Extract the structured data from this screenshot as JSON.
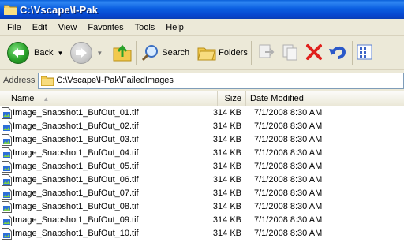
{
  "window": {
    "title": "C:\\Vscape\\I-Pak"
  },
  "menu": [
    "File",
    "Edit",
    "View",
    "Favorites",
    "Tools",
    "Help"
  ],
  "toolbar": {
    "back_label": "Back",
    "search_label": "Search",
    "folders_label": "Folders"
  },
  "address": {
    "label": "Address",
    "value": "C:\\Vscape\\I-Pak\\FailedImages"
  },
  "columns": {
    "name": "Name",
    "size": "Size",
    "date": "Date Modified"
  },
  "files": [
    {
      "name": "Image_Snapshot1_BufOut_01.tif",
      "size": "314 KB",
      "date": "7/1/2008 8:30 AM"
    },
    {
      "name": "Image_Snapshot1_BufOut_02.tif",
      "size": "314 KB",
      "date": "7/1/2008 8:30 AM"
    },
    {
      "name": "Image_Snapshot1_BufOut_03.tif",
      "size": "314 KB",
      "date": "7/1/2008 8:30 AM"
    },
    {
      "name": "Image_Snapshot1_BufOut_04.tif",
      "size": "314 KB",
      "date": "7/1/2008 8:30 AM"
    },
    {
      "name": "Image_Snapshot1_BufOut_05.tif",
      "size": "314 KB",
      "date": "7/1/2008 8:30 AM"
    },
    {
      "name": "Image_Snapshot1_BufOut_06.tif",
      "size": "314 KB",
      "date": "7/1/2008 8:30 AM"
    },
    {
      "name": "Image_Snapshot1_BufOut_07.tif",
      "size": "314 KB",
      "date": "7/1/2008 8:30 AM"
    },
    {
      "name": "Image_Snapshot1_BufOut_08.tif",
      "size": "314 KB",
      "date": "7/1/2008 8:30 AM"
    },
    {
      "name": "Image_Snapshot1_BufOut_09.tif",
      "size": "314 KB",
      "date": "7/1/2008 8:30 AM"
    },
    {
      "name": "Image_Snapshot1_BufOut_10.tif",
      "size": "314 KB",
      "date": "7/1/2008 8:30 AM"
    }
  ]
}
